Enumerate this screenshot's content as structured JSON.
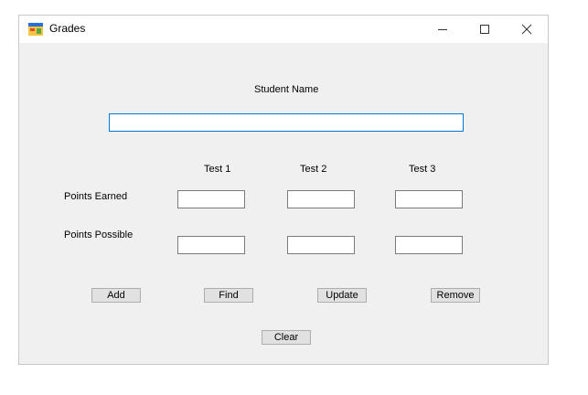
{
  "window": {
    "title": "Grades",
    "icon": "windows-form-icon"
  },
  "form": {
    "student_name_label": "Student Name",
    "student_name_value": "",
    "column_headers": [
      "Test 1",
      "Test 2",
      "Test 3"
    ],
    "row_labels": {
      "earned": "Points Earned",
      "possible": "Points Possible"
    },
    "points_earned": [
      "",
      "",
      ""
    ],
    "points_possible": [
      "",
      "",
      ""
    ]
  },
  "buttons": {
    "add": "Add",
    "find": "Find",
    "update": "Update",
    "remove": "Remove",
    "clear": "Clear"
  }
}
